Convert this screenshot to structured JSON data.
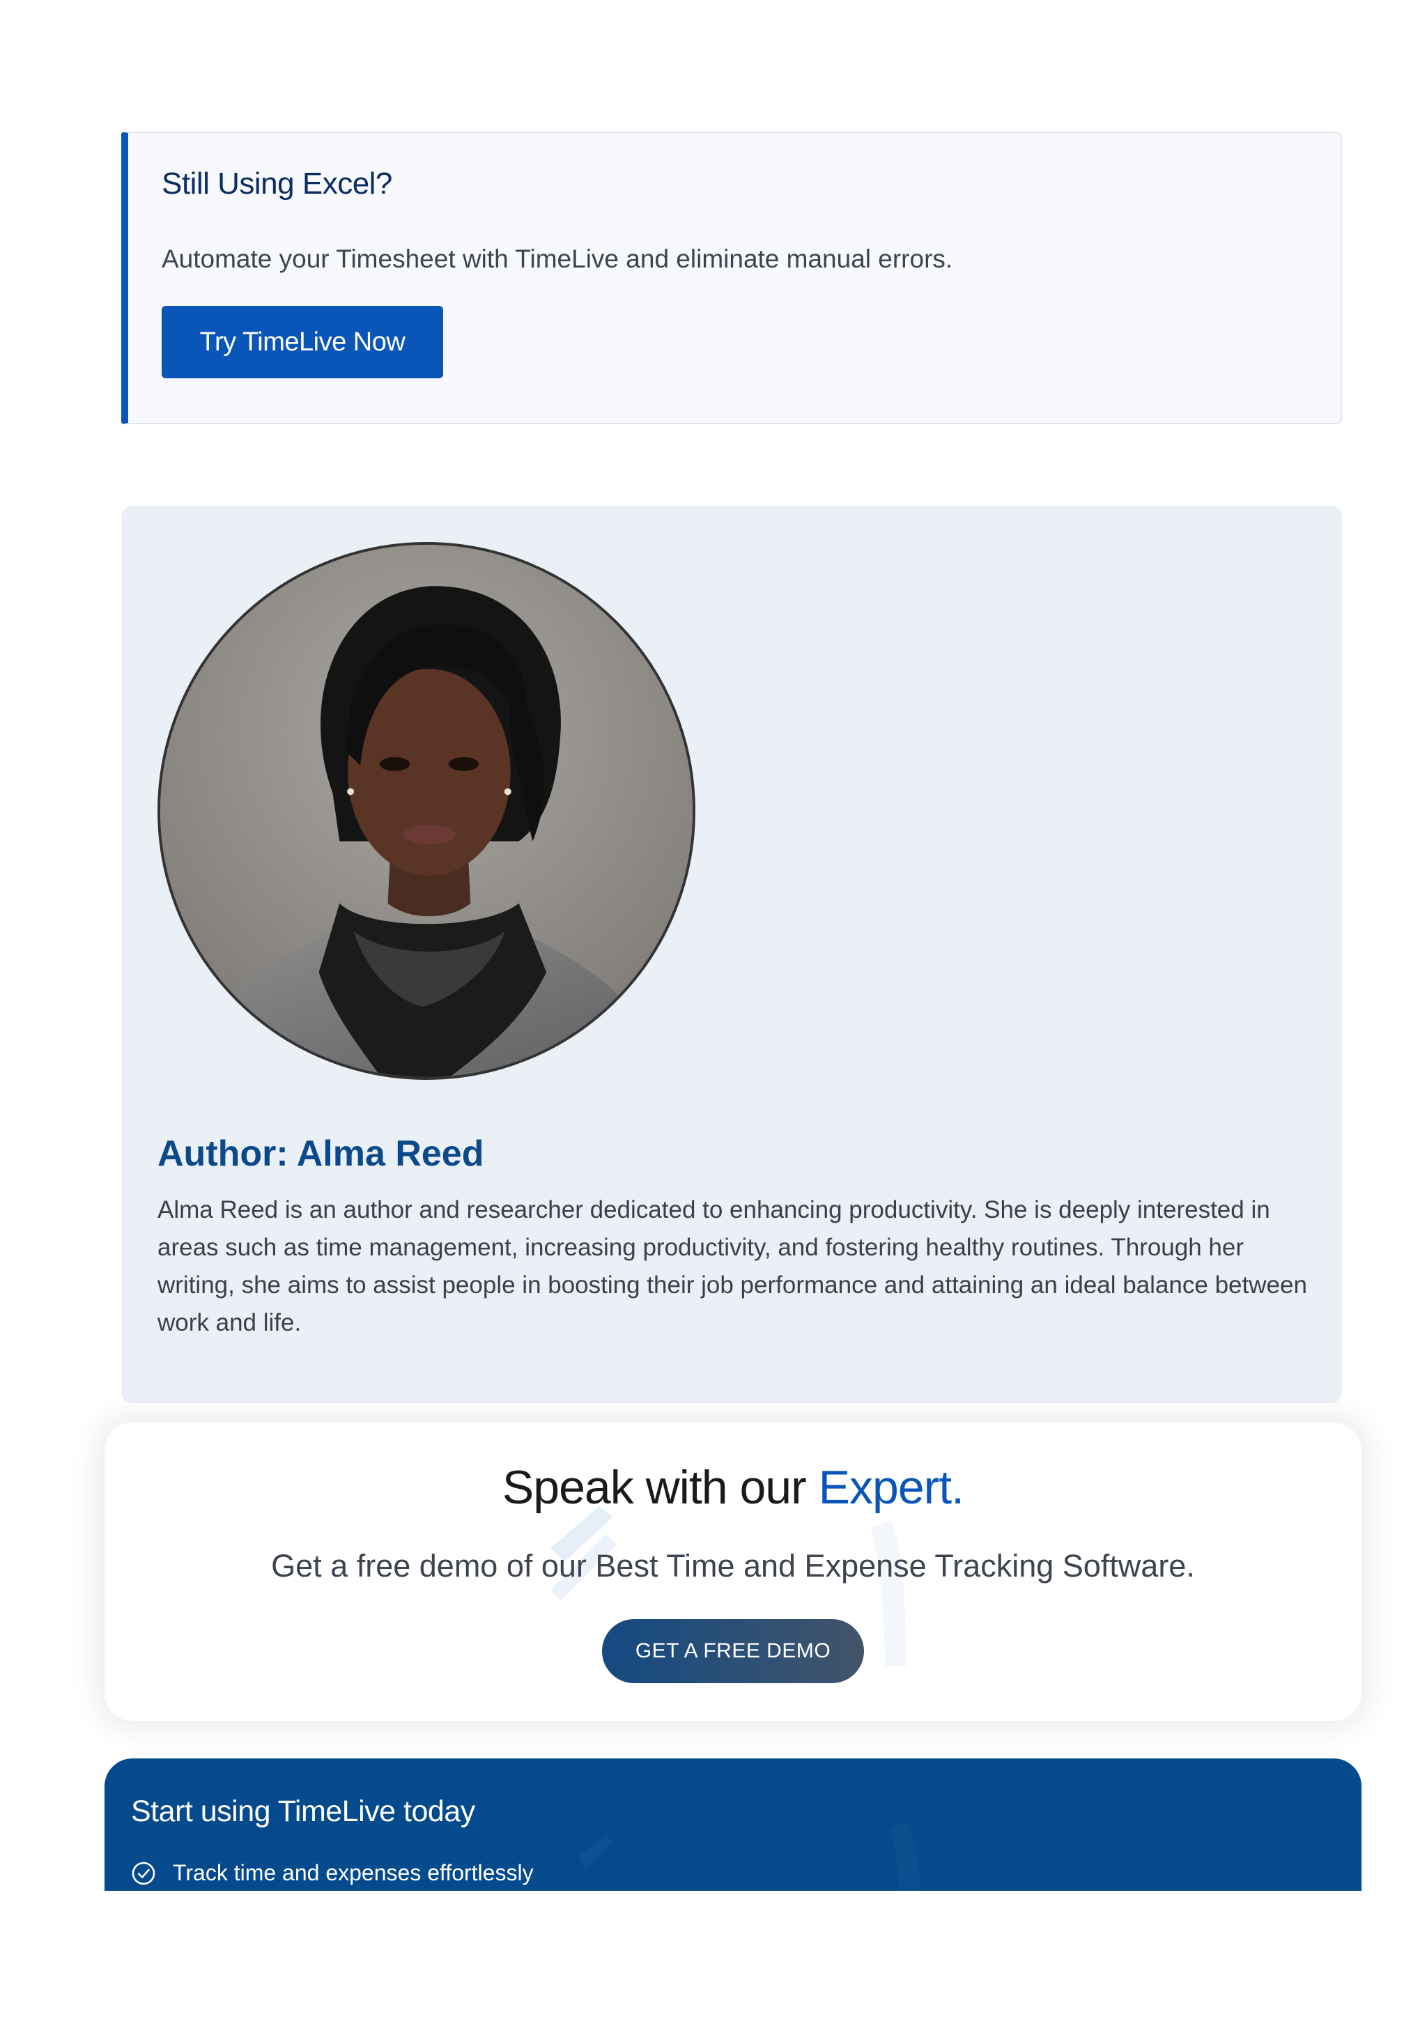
{
  "excel_cta": {
    "title": "Still Using Excel?",
    "text": "Automate your Timesheet with TimeLive and eliminate manual errors.",
    "button_label": "Try TimeLive Now"
  },
  "author": {
    "label": "Author:",
    "name": "Alma Reed",
    "bio": "Alma Reed is an author and researcher dedicated to enhancing productivity. She is deeply interested in areas such as time management, increasing productivity, and fostering healthy routines. Through her writing, she aims to assist people in boosting their job performance and attaining an ideal balance between work and life."
  },
  "expert": {
    "title_prefix": "Speak with our",
    "title_accent": "Expert.",
    "subtitle": "Get a free demo of our Best Time and Expense Tracking Software.",
    "button_label": "GET A FREE DEMO"
  },
  "start": {
    "title": "Start using TimeLive today",
    "features": [
      {
        "icon": "check-circle-icon",
        "text": "Track time and expenses effortlessly"
      }
    ]
  },
  "colors": {
    "brand_blue": "#0a55b8",
    "dark_navy": "#044a8c",
    "author_bg": "#ebf0f6",
    "heading_blue": "#0a4a8a"
  }
}
